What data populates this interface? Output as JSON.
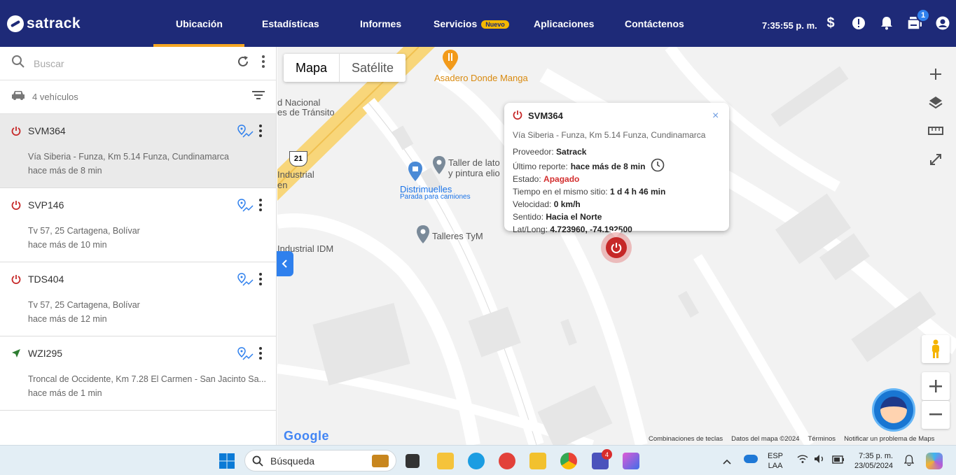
{
  "header": {
    "brand": "satrack",
    "nav": [
      {
        "label": "Ubicación",
        "active": true
      },
      {
        "label": "Estadísticas"
      },
      {
        "label": "Informes"
      },
      {
        "label": "Servicios",
        "badge": "Nuevo"
      },
      {
        "label": "Aplicaciones"
      },
      {
        "label": "Contáctenos"
      }
    ],
    "clock": "7:35:55 p. m.",
    "notification_count": "1",
    "accent": "#f5a623",
    "bg": "#1e2a78"
  },
  "sidebar": {
    "search_placeholder": "Buscar",
    "vehicle_count": "4 vehículos",
    "vehicles": [
      {
        "plate": "SVM364",
        "status_icon": "power-icon",
        "address": "Vía Siberia - Funza, Km 5.14 Funza, Cundinamarca",
        "time": "hace más de 8 min",
        "selected": true
      },
      {
        "plate": "SVP146",
        "status_icon": "power-icon",
        "address": "Tv 57, 25 Cartagena, Bolívar",
        "time": "hace más de 10 min"
      },
      {
        "plate": "TDS404",
        "status_icon": "power-icon",
        "address": "Tv 57, 25 Cartagena, Bolívar",
        "time": "hace más de 12 min"
      },
      {
        "plate": "WZI295",
        "status_icon": "navigation-arrow-icon",
        "address": "Troncal de Occidente, Km 7.28 El Carmen - San Jacinto Sa...",
        "time": "hace más de 1 min"
      }
    ]
  },
  "map": {
    "type_map": "Mapa",
    "type_satellite": "Satélite",
    "labels": {
      "asadero": "Asadero Donde Manga",
      "transito_1": "d Nacional",
      "transito_2": "es de Tránsito",
      "route": "21",
      "industrial_1": "Industrial",
      "industrial_2": "en",
      "taller_1": "Taller de lato",
      "taller_2": "y pintura elio",
      "distrimuelles": "Distrimuelles",
      "parada": "Parada para camiones",
      "talleres": "Talleres TyM",
      "industrial_idm": "Industrial IDM"
    },
    "popup": {
      "title": "SVM364",
      "address": "Vía Siberia - Funza, Km 5.14 Funza, Cundinamarca",
      "proveedor_label": "Proveedor:",
      "proveedor": "Satrack",
      "reporte_label": "Último reporte:",
      "reporte": "hace más de 8 min",
      "estado_label": "Estado:",
      "estado": "Apagado",
      "tiempo_label": "Tiempo en el mismo sitio:",
      "tiempo": "1 d 4 h 46 min",
      "velocidad_label": "Velocidad:",
      "velocidad": "0 km/h",
      "sentido_label": "Sentido:",
      "sentido": "Hacia el Norte",
      "latlong_label": "Lat/Long:",
      "latlong": "4.723960, -74.192500",
      "close": "×"
    },
    "google": "Google",
    "attribution": [
      "Combinaciones de teclas",
      "Datos del mapa ©2024",
      "Términos",
      "Notificar un problema de Maps"
    ]
  },
  "taskbar": {
    "search": "Búsqueda",
    "lang_1": "ESP",
    "lang_2": "LAA",
    "time": "7:35 p. m.",
    "date": "23/05/2024",
    "teams_badge": "4"
  }
}
